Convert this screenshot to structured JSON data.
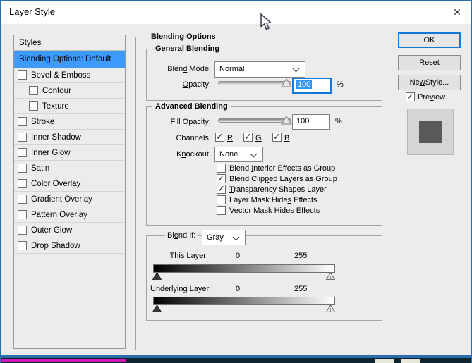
{
  "window": {
    "title": "Layer Style",
    "close_glyph": "✕"
  },
  "sidebar": {
    "header": "Styles",
    "selected_item": "Blending Options: Default",
    "items": [
      {
        "label": "Bevel & Emboss",
        "checked": false,
        "indent": false
      },
      {
        "label": "Contour",
        "checked": false,
        "indent": true
      },
      {
        "label": "Texture",
        "checked": false,
        "indent": true
      },
      {
        "label": "Stroke",
        "checked": false,
        "indent": false
      },
      {
        "label": "Inner Shadow",
        "checked": false,
        "indent": false
      },
      {
        "label": "Inner Glow",
        "checked": false,
        "indent": false
      },
      {
        "label": "Satin",
        "checked": false,
        "indent": false
      },
      {
        "label": "Color Overlay",
        "checked": false,
        "indent": false
      },
      {
        "label": "Gradient Overlay",
        "checked": false,
        "indent": false
      },
      {
        "label": "Pattern Overlay",
        "checked": false,
        "indent": false
      },
      {
        "label": "Outer Glow",
        "checked": false,
        "indent": false
      },
      {
        "label": "Drop Shadow",
        "checked": false,
        "indent": false
      }
    ]
  },
  "panel": {
    "title": "Blending Options",
    "general": {
      "title": "General Blending",
      "blend_mode_label": "Blen[d] Mode:",
      "blend_mode_value": "Normal",
      "opacity_label": "[O]pacity:",
      "opacity_value": "100",
      "opacity_unit": "%"
    },
    "advanced": {
      "title": "Advanced Blending",
      "fill_opacity_label": "[F]ill Opacity:",
      "fill_opacity_value": "100",
      "fill_opacity_unit": "%",
      "channels_label": "Channels:",
      "channels": [
        {
          "label": "[R]",
          "checked": true
        },
        {
          "label": "[G]",
          "checked": true
        },
        {
          "label": "[B]",
          "checked": true
        }
      ],
      "knockout_label": "K[n]ockout:",
      "knockout_value": "None",
      "options": [
        {
          "label": "Blend [I]nterior Effects as Group",
          "checked": false
        },
        {
          "label": "Blend Clip[p]ed Layers as Group",
          "checked": true
        },
        {
          "label": "[T]ransparency Shapes Layer",
          "checked": true
        },
        {
          "label": "Layer Mask Hide[s] Effects",
          "checked": false
        },
        {
          "label": "Vector Mask [H]ides Effects",
          "checked": false
        }
      ]
    },
    "blend_if": {
      "label": "Bl[e]nd If:",
      "value": "Gray",
      "this_layer": {
        "label": "This Layer:",
        "min": "0",
        "max": "255"
      },
      "underlying_layer": {
        "label": "Underlying Layer:",
        "min": "0",
        "max": "255"
      }
    }
  },
  "actions": {
    "ok": "OK",
    "reset": "Reset",
    "new_style": "Ne[w] Style...",
    "preview": {
      "label": "Pre[v]iew",
      "checked": true
    }
  },
  "colors": {
    "selection_blue": "#3d9bfd",
    "focus_border": "#0f7ad8",
    "window_border": "#2b6cac",
    "dialog_bg": "#ececec",
    "swatch_inner": "#595959"
  }
}
